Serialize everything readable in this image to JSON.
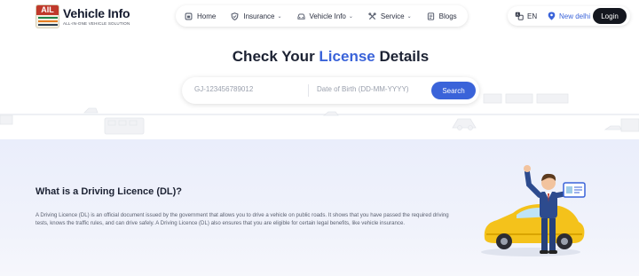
{
  "brand": {
    "name": "Vehicle Info",
    "tagline": "ALL-IN-ONE VEHICLE SOLUTION",
    "badge": "AIL"
  },
  "nav": {
    "items": [
      {
        "label": "Home",
        "icon": "home-icon",
        "dropdown": false
      },
      {
        "label": "Insurance",
        "icon": "shield-icon",
        "dropdown": true
      },
      {
        "label": "Vehicle Info",
        "icon": "car-icon",
        "dropdown": true
      },
      {
        "label": "Service",
        "icon": "tools-icon",
        "dropdown": true
      },
      {
        "label": "Blogs",
        "icon": "blog-icon",
        "dropdown": false
      }
    ]
  },
  "util": {
    "language": "EN",
    "city": "New delhi",
    "login_label": "Login"
  },
  "hero": {
    "title_pre": "Check Your ",
    "title_highlight": "License",
    "title_post": " Details",
    "reg_placeholder": "GJ-123456789012",
    "dob_placeholder": "Date of Birth (DD-MM-YYYY)",
    "search_label": "Search"
  },
  "section": {
    "title": "What is a Driving Licence (DL)?",
    "body": "A Driving Licence (DL) is an official document issued by the government that allows you to drive a vehicle on public roads. It shows that you have passed the required driving tests, knows the traffic rules, and can drive safely. A Driving Licence (DL) also ensures that you are eligible for certain legal benefits, like vehicle insurance."
  },
  "colors": {
    "accent": "#3a63d9",
    "dark": "#14171f",
    "section_bg": "#eaeefb"
  }
}
